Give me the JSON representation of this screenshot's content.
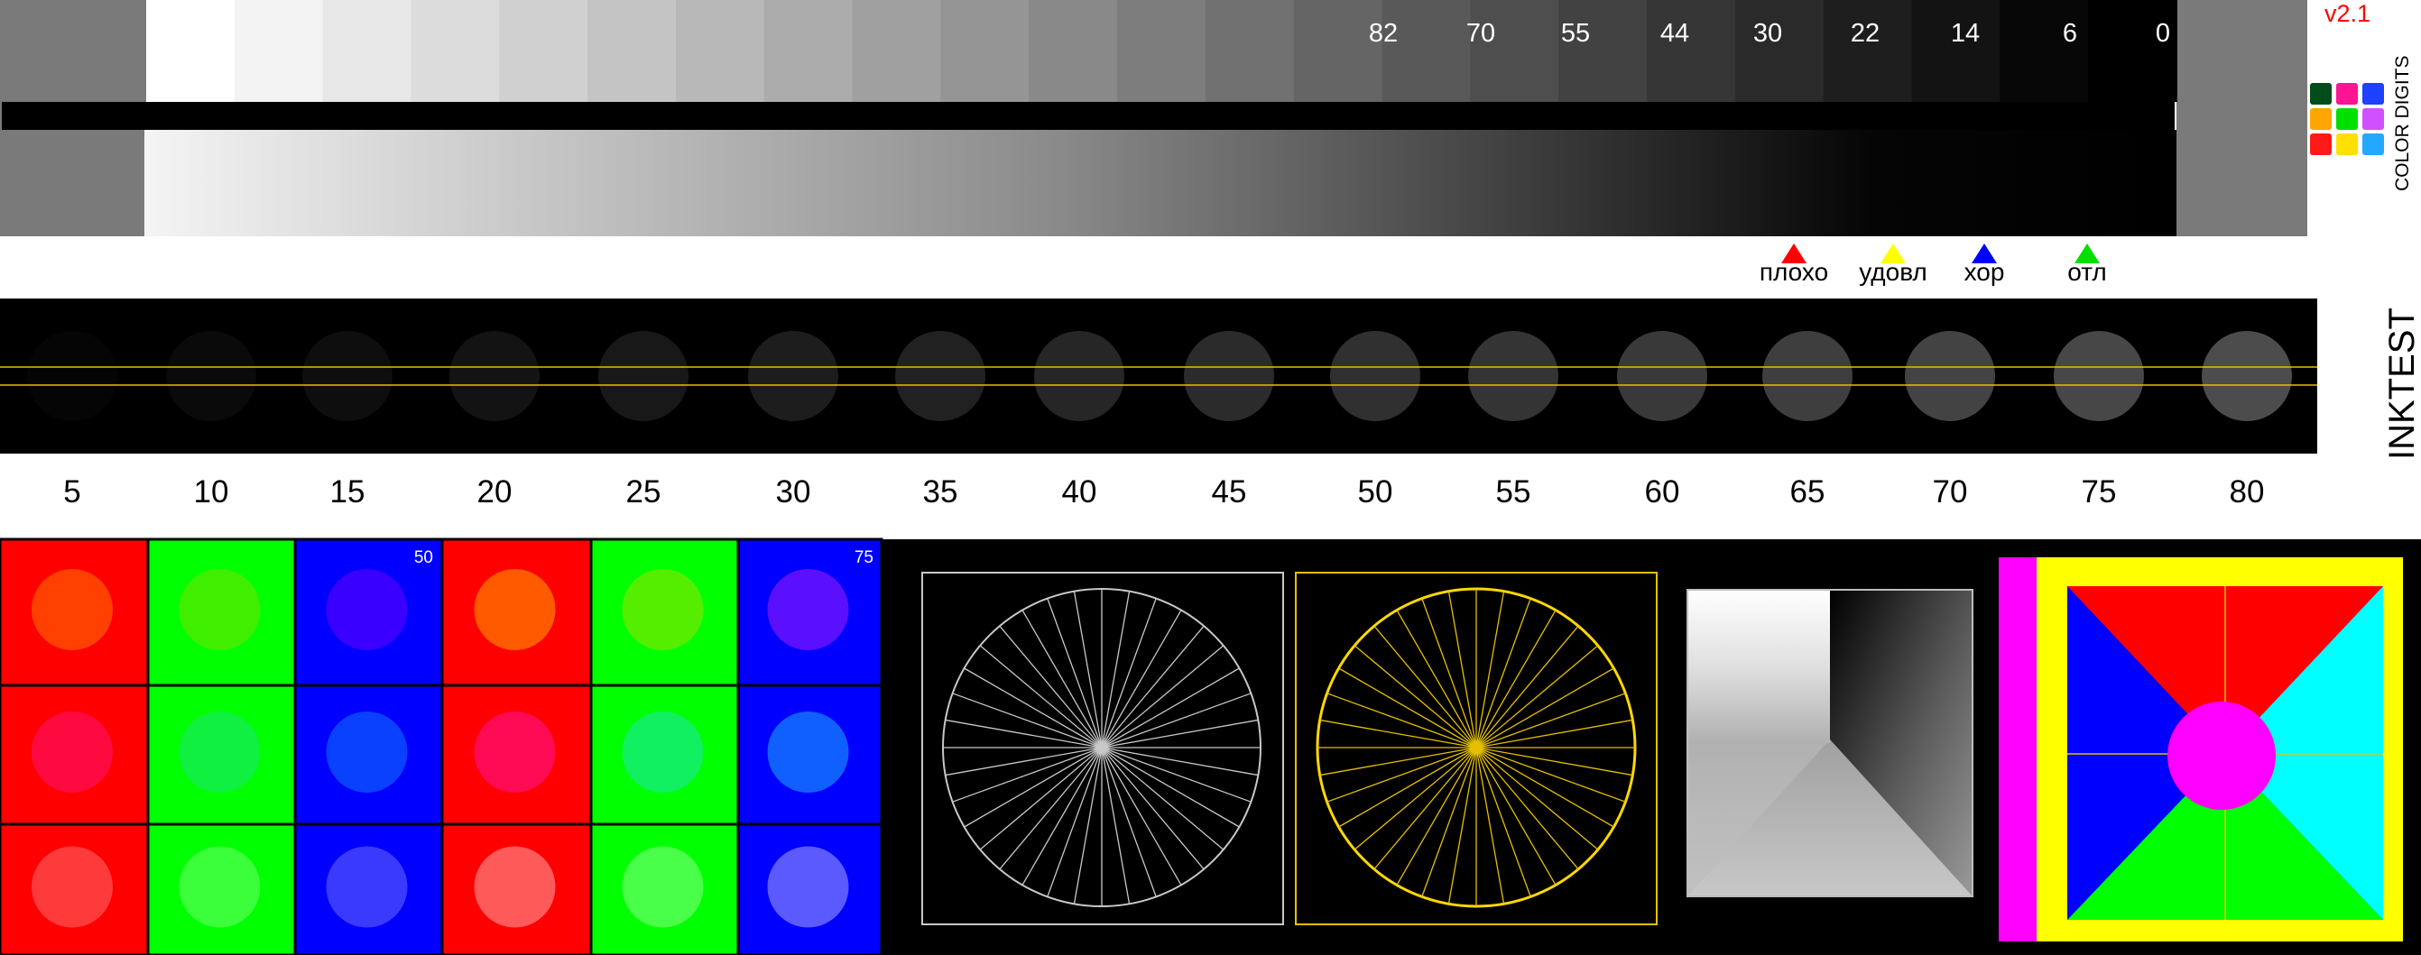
{
  "version": "v2.1",
  "logo_text": "COLOR DIGITS",
  "side_label": "INKTEST",
  "gray_steps": {
    "labels": [
      "82",
      "70",
      "55",
      "44",
      "30",
      "22",
      "14",
      "6",
      "0"
    ]
  },
  "rating": {
    "items": [
      {
        "label": "плохо",
        "color": "#ff0000"
      },
      {
        "label": "удовл",
        "color": "#ffff00"
      },
      {
        "label": "хор",
        "color": "#0000ff"
      },
      {
        "label": "отл",
        "color": "#00e000"
      }
    ]
  },
  "ink_circles": {
    "labels": [
      "5",
      "10",
      "15",
      "20",
      "25",
      "30",
      "35",
      "40",
      "45",
      "50",
      "55",
      "60",
      "65",
      "70",
      "75",
      "80"
    ]
  },
  "rgb_grid": {
    "corner_labels": [
      "50",
      "75"
    ]
  },
  "colors": {
    "red": "#ff0000",
    "green": "#00ff00",
    "blue": "#0000ff",
    "yellow": "#ffff00",
    "magenta": "#ff00ff",
    "cyan": "#00ffff",
    "version_text": "#ff0000",
    "gold_line": "#e6c000"
  }
}
